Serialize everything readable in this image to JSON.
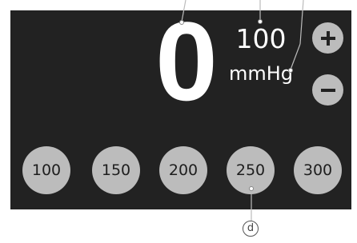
{
  "display": {
    "current_value": "0",
    "setpoint_value": "100",
    "unit": "mmHg"
  },
  "controls": {
    "increase_label": "+",
    "decrease_label": "−"
  },
  "presets": [
    "100",
    "150",
    "200",
    "250",
    "300"
  ],
  "callouts": {
    "d": "ⓓ"
  },
  "colors": {
    "panel_bg": "#222222",
    "button_bg": "#bcbcbc",
    "text": "#ffffff"
  }
}
